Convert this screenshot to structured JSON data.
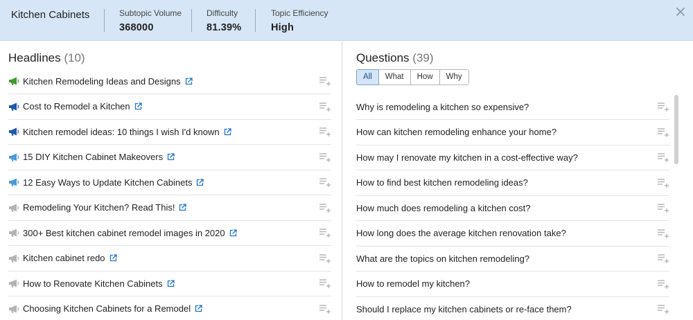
{
  "header": {
    "topic": "Kitchen Cabinets",
    "metrics": [
      {
        "label": "Subtopic Volume",
        "value": "368000"
      },
      {
        "label": "Difficulty",
        "value": "81.39%"
      },
      {
        "label": "Topic Efficiency",
        "value": "High"
      }
    ]
  },
  "headlines": {
    "title": "Headlines",
    "count": "(10)",
    "items": [
      {
        "text": "Kitchen Remodeling Ideas and Designs",
        "level": "green"
      },
      {
        "text": "Cost to Remodel a Kitchen",
        "level": "dark-blue"
      },
      {
        "text": "Kitchen remodel ideas: 10 things I wish I'd known",
        "level": "dark-blue"
      },
      {
        "text": "15 DIY Kitchen Cabinet Makeovers",
        "level": "light-blue"
      },
      {
        "text": "12 Easy Ways to Update Kitchen Cabinets",
        "level": "light-blue"
      },
      {
        "text": "Remodeling Your Kitchen? Read This!",
        "level": "gray"
      },
      {
        "text": "300+ Best kitchen cabinet remodel images in 2020",
        "level": "gray"
      },
      {
        "text": "Kitchen cabinet redo",
        "level": "gray"
      },
      {
        "text": "How to Renovate Kitchen Cabinets",
        "level": "gray"
      },
      {
        "text": "Choosing Kitchen Cabinets for a Remodel",
        "level": "gray"
      }
    ]
  },
  "questions": {
    "title": "Questions",
    "count": "(39)",
    "filters": [
      "All",
      "What",
      "How",
      "Why"
    ],
    "active_filter": "All",
    "items": [
      "Why is remodeling a kitchen so expensive?",
      "How can kitchen remodeling enhance your home?",
      "How may I renovate my kitchen in a cost-effective way?",
      "How to find best kitchen remodeling ideas?",
      "How much does remodeling a kitchen cost?",
      "How long does the average kitchen renovation take?",
      "What are the topics on kitchen remodeling?",
      "How to remodel my kitchen?",
      "Should I replace my kitchen cabinets or re-face them?"
    ]
  },
  "colors": {
    "header_bg": "#d6e6f6",
    "green": "#3f9a2f",
    "dark-blue": "#1c5aa8",
    "light-blue": "#4a9ad6",
    "gray": "#b3b3b3",
    "link": "#1f73c9"
  },
  "icons": {
    "close": "close-icon",
    "megaphone": "megaphone-icon",
    "external": "external-link-icon",
    "add": "add-to-list-icon"
  }
}
